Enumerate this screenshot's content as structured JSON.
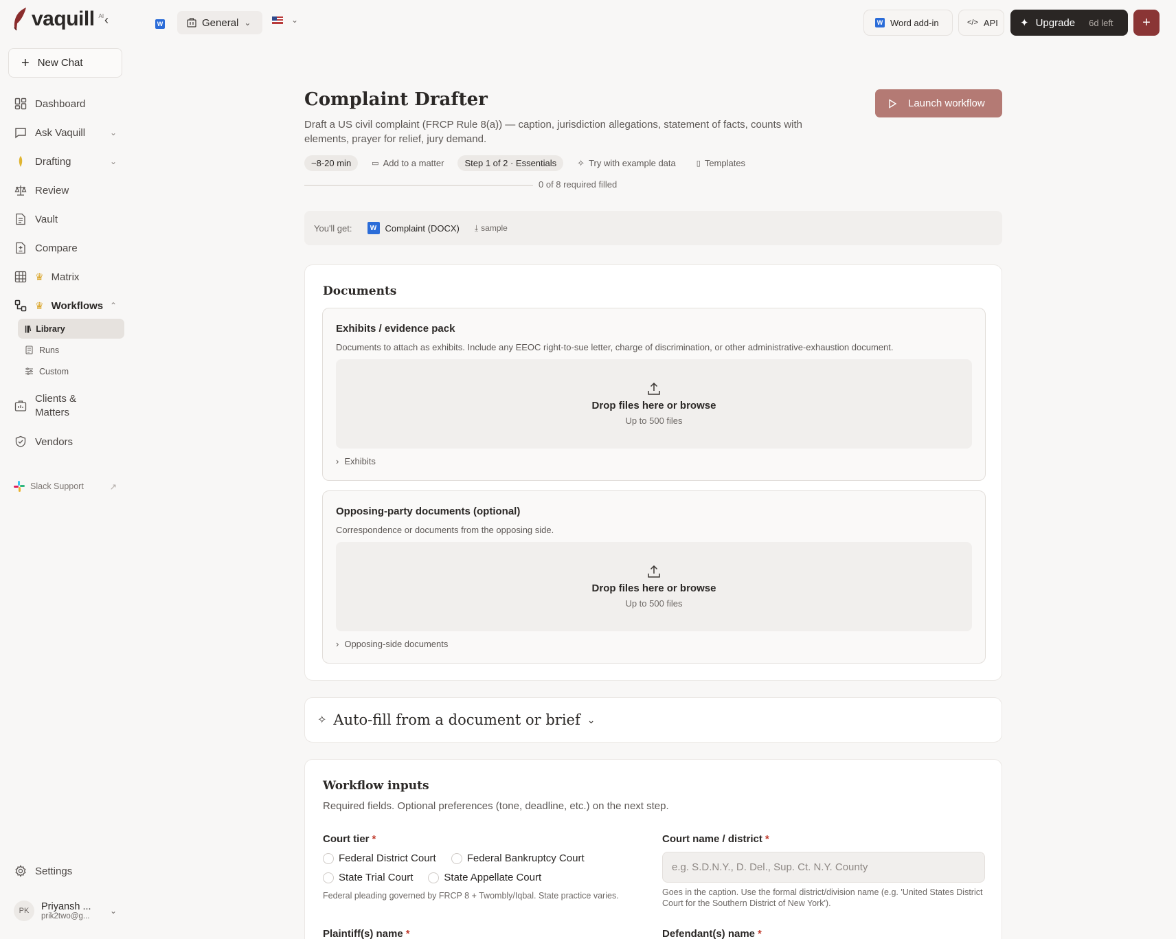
{
  "brand": {
    "name": "vaquill",
    "badge": "AI"
  },
  "sidebar": {
    "new_chat": "New Chat",
    "items": [
      {
        "label": "Dashboard"
      },
      {
        "label": "Ask Vaquill"
      },
      {
        "label": "Drafting"
      },
      {
        "label": "Review"
      },
      {
        "label": "Vault"
      },
      {
        "label": "Compare"
      },
      {
        "label": "Matrix"
      },
      {
        "label": "Workflows"
      }
    ],
    "workflow_sub": [
      {
        "label": "Library"
      },
      {
        "label": "Runs"
      },
      {
        "label": "Custom"
      }
    ],
    "clients_line1": "Clients &",
    "clients_line2": "Matters",
    "vendors": "Vendors",
    "slack": "Slack Support",
    "settings": "Settings",
    "user": {
      "initials": "PK",
      "name": "Priyansh ...",
      "email": "prik2two@g..."
    }
  },
  "topbar": {
    "workspace": "General",
    "word_addin": "Word add-in",
    "api": "API",
    "upgrade": "Upgrade",
    "days_left": "6d left"
  },
  "page": {
    "title": "Complaint Drafter",
    "description": "Draft a US civil complaint (FRCP Rule 8(a)) — caption, jurisdiction allegations, statement of facts, counts with elements, prayer for relief, jury demand.",
    "launch": "Launch workflow",
    "chips": {
      "duration": "~8-20 min",
      "matter": "Add to a matter",
      "step": "Step 1 of 2 · Essentials",
      "example": "Try with example data",
      "templates": "Templates"
    },
    "progress_text": "0 of 8 required filled",
    "you_get_label": "You'll get:",
    "you_get_doc": "Complaint (DOCX)",
    "you_get_sample": "sample"
  },
  "documents": {
    "title": "Documents",
    "sections": [
      {
        "title": "Exhibits / evidence pack",
        "description": "Documents to attach as exhibits. Include any EEOC right-to-sue letter, charge of discrimination, or other administrative-exhaustion document.",
        "drop_main": "Drop files here or browse",
        "drop_sub": "Up to 500 files",
        "expander": "Exhibits"
      },
      {
        "title": "Opposing-party documents (optional)",
        "description": "Correspondence or documents from the opposing side.",
        "drop_main": "Drop files here or browse",
        "drop_sub": "Up to 500 files",
        "expander": "Opposing-side documents"
      }
    ]
  },
  "autofill": {
    "title": "Auto-fill from a document or brief"
  },
  "inputs": {
    "title": "Workflow inputs",
    "subtitle": "Required fields. Optional preferences (tone, deadline, etc.) on the next step.",
    "court_tier": {
      "label": "Court tier",
      "options": [
        "Federal District Court",
        "Federal Bankruptcy Court",
        "State Trial Court",
        "State Appellate Court"
      ],
      "hint": "Federal pleading governed by FRCP 8 + Twombly/Iqbal. State practice varies."
    },
    "court_name": {
      "label": "Court name / district",
      "placeholder": "e.g. S.D.N.Y., D. Del., Sup. Ct. N.Y. County",
      "hint": "Goes in the caption. Use the formal district/division name (e.g. 'United States District Court for the Southern District of New York')."
    },
    "plaintiff_label": "Plaintiff(s) name",
    "defendant_label": "Defendant(s) name",
    "required_mark": "*"
  }
}
